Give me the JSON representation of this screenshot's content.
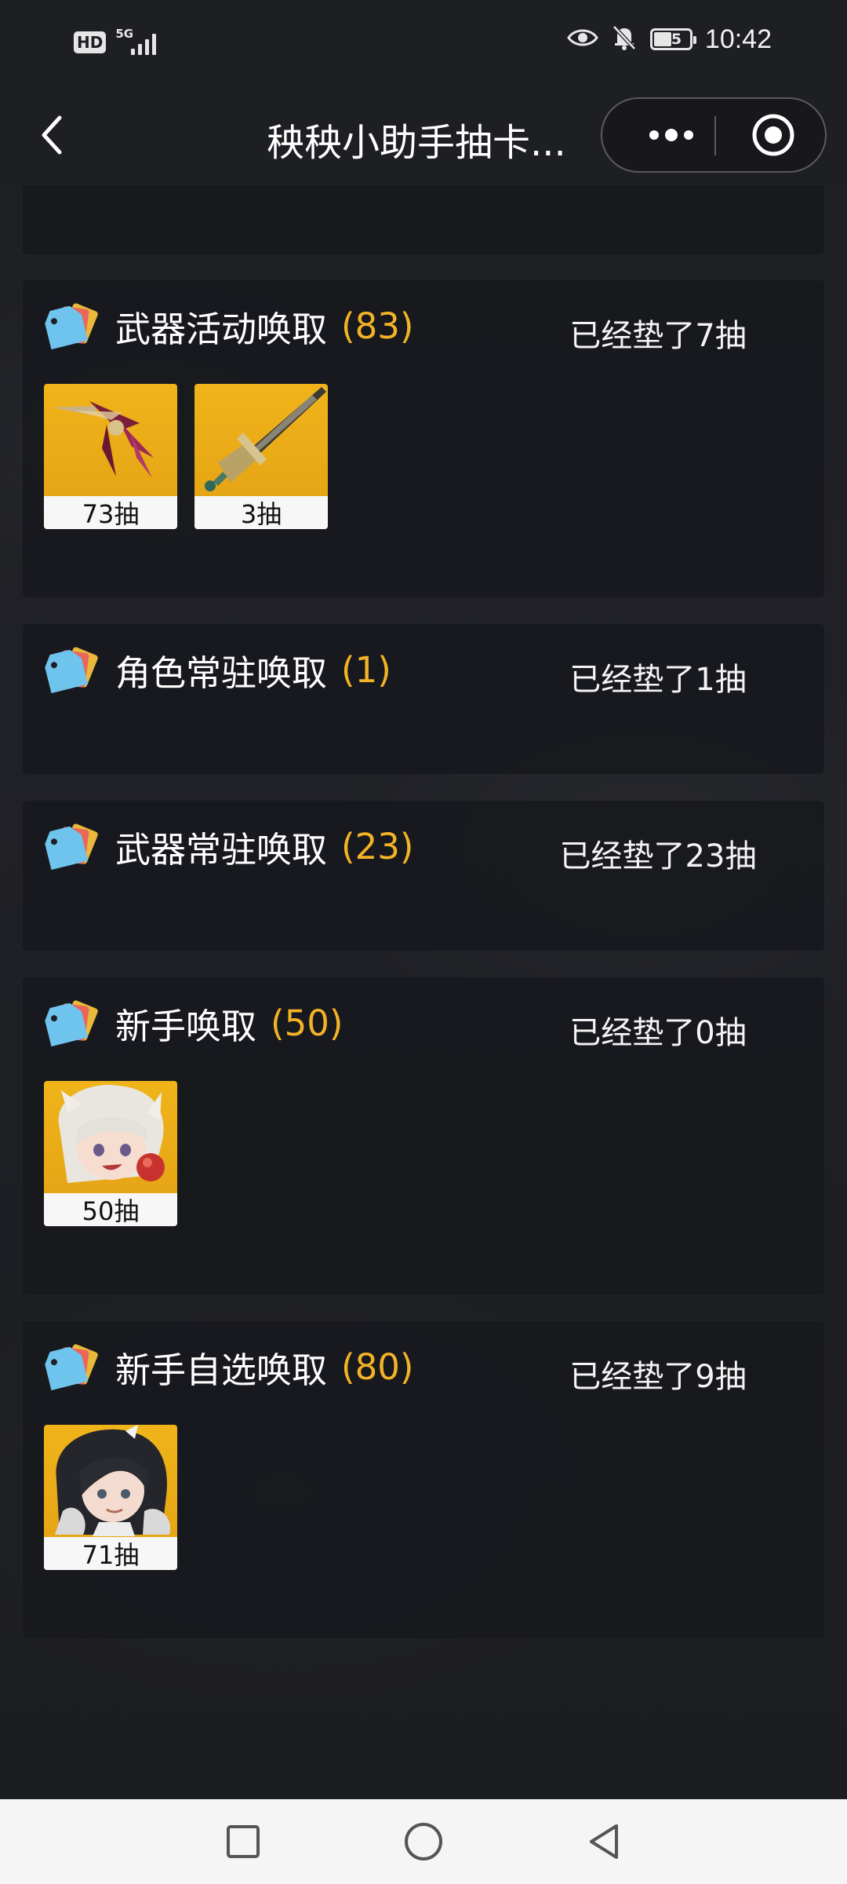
{
  "status_bar": {
    "hd_label": "HD",
    "network_label": "5G",
    "battery_level": "45",
    "time": "10:42"
  },
  "title_bar": {
    "title": "秧秧小助手抽卡..."
  },
  "colors": {
    "accent_count": "#f3b327",
    "panel_bg": "#18191d",
    "item_bg": "#f0b41a"
  },
  "pools": [
    {
      "name": "武器活动唤取",
      "count": "(83)",
      "pity": "已经垫了7抽",
      "items": [
        {
          "label": "73抽",
          "icon": "crimson-blade-weapon-icon"
        },
        {
          "label": "3抽",
          "icon": "golden-greatsword-weapon-icon"
        }
      ]
    },
    {
      "name": "角色常驻唤取",
      "count": "(1)",
      "pity": "已经垫了1抽",
      "items": []
    },
    {
      "name": "武器常驻唤取",
      "count": "(23)",
      "pity": "已经垫了23抽",
      "items": []
    },
    {
      "name": "新手唤取",
      "count": "(50)",
      "pity": "已经垫了0抽",
      "items": [
        {
          "label": "50抽",
          "icon": "white-haired-character-portrait"
        }
      ]
    },
    {
      "name": "新手自选唤取",
      "count": "(80)",
      "pity": "已经垫了9抽",
      "items": [
        {
          "label": "71抽",
          "icon": "dark-haired-character-portrait"
        }
      ]
    }
  ],
  "nav": {
    "recent": "recent-apps-icon",
    "home": "home-icon",
    "back": "back-triangle-icon"
  }
}
